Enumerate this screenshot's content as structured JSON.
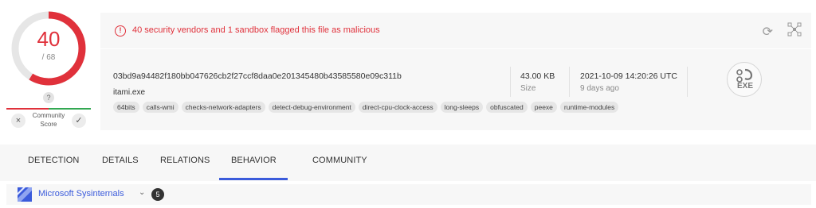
{
  "score": {
    "detections": "40",
    "total": "/ 68",
    "community_unknown": "?",
    "community_label_line1": "Community",
    "community_label_line2": "Score",
    "vote_down": "×",
    "vote_up": "✓",
    "detection_ratio": 0.588,
    "ring_color": "#e0313b"
  },
  "alert": {
    "icon_glyph": "!",
    "message": "40 security vendors and 1 sandbox flagged this file as malicious"
  },
  "file": {
    "hash": "03bd9a94482f180bb047626cb2f27ccf8daa0e201345480b43585580e09c311b",
    "name": "itami.exe",
    "tags": [
      "64bits",
      "calls-wmi",
      "checks-network-adapters",
      "detect-debug-environment",
      "direct-cpu-clock-access",
      "long-sleeps",
      "obfuscated",
      "peexe",
      "runtime-modules"
    ],
    "size": "43.00 KB",
    "size_label": "Size",
    "date": "2021-10-09 14:20:26 UTC",
    "date_label": "9 days ago",
    "type_icon_label": "EXE"
  },
  "icons": {
    "reload": "⟳",
    "graph": "graph-icon",
    "file_type": "exe-file-icon"
  },
  "tabs": {
    "items": [
      "DETECTION",
      "DETAILS",
      "RELATIONS",
      "BEHAVIOR",
      "COMMUNITY"
    ],
    "active": "BEHAVIOR",
    "accent": "#3b5bdb"
  },
  "sandbox": {
    "name": "Microsoft Sysinternals",
    "chevron": "⌄",
    "count": "5"
  }
}
